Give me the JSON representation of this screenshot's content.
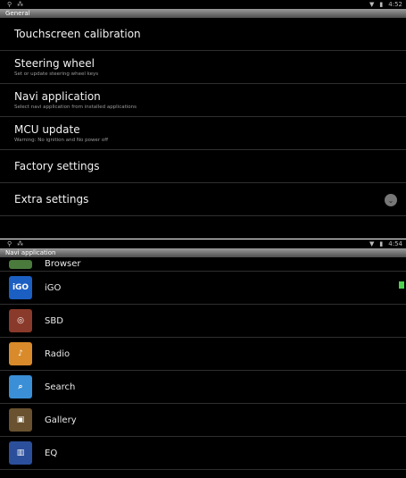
{
  "top_screen": {
    "status": {
      "time": "4:52"
    },
    "title": "General",
    "items": [
      {
        "title": "Touchscreen calibration",
        "summary": ""
      },
      {
        "title": "Steering wheel",
        "summary": "Set or update steering wheel keys"
      },
      {
        "title": "Navi application",
        "summary": "Select navi application from installed applications"
      },
      {
        "title": "MCU update",
        "summary": "Warning: No ignition and No power off"
      },
      {
        "title": "Factory settings",
        "summary": ""
      },
      {
        "title": "Extra settings",
        "summary": ""
      }
    ]
  },
  "bottom_screen": {
    "status": {
      "time": "4:54"
    },
    "title": "Navi application",
    "apps": [
      {
        "label": "Browser",
        "icon": "browser-icon",
        "color": "#4b7a3d"
      },
      {
        "label": "iGO",
        "icon": "igo-icon",
        "icon_text": "iGO",
        "color": "#1c5fc2"
      },
      {
        "label": "SBD",
        "icon": "steering-wheel-icon",
        "color": "#8a3a2a"
      },
      {
        "label": "Radio",
        "icon": "radio-icon",
        "color": "#d98a2a"
      },
      {
        "label": "Search",
        "icon": "search-icon",
        "color": "#3a8fd6"
      },
      {
        "label": "Gallery",
        "icon": "gallery-icon",
        "color": "#6a5230"
      },
      {
        "label": "EQ",
        "icon": "equalizer-icon",
        "color": "#2b4f9a"
      }
    ]
  }
}
